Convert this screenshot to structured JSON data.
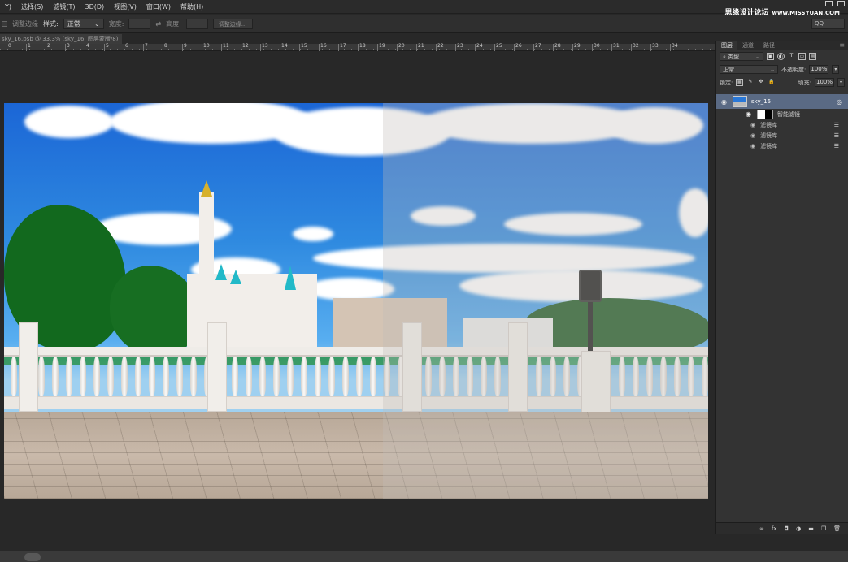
{
  "menu": {
    "items": [
      "Y)",
      "选择(S)",
      "滤镜(T)",
      "3D(D)",
      "视图(V)",
      "窗口(W)",
      "帮助(H)"
    ],
    "brand": "思缘设计论坛",
    "brand_url": "www.MISSYUAN.COM"
  },
  "options": {
    "refine_label": "调整边缘",
    "style_label": "样式:",
    "style_value": "正常",
    "width_label": "宽度:",
    "height_label": "高度:",
    "refine_button": "调整边缘...",
    "workspace": "QQ"
  },
  "document": {
    "tab": "sky_16.psb @ 33.3% (sky_16, 图层蒙版/8)",
    "ruler_labels": [
      "0",
      "1",
      "2",
      "3",
      "4",
      "5",
      "6",
      "7",
      "8",
      "9",
      "10",
      "11",
      "12",
      "13",
      "14",
      "15",
      "16",
      "17",
      "18",
      "19",
      "20",
      "21",
      "22",
      "23",
      "24",
      "25",
      "26",
      "27",
      "28",
      "29",
      "30",
      "31",
      "32",
      "33",
      "34"
    ]
  },
  "panel": {
    "tabs": [
      "图层",
      "通道",
      "路径"
    ],
    "filter_kind": "类型",
    "blend_mode": "正常",
    "opacity_label": "不透明度:",
    "opacity_value": "100%",
    "lock_label": "锁定:",
    "fill_label": "填充:",
    "fill_value": "100%",
    "layer_name": "sky_16",
    "smart_filter_label": "智能滤镜",
    "filters": [
      "滤镜库",
      "滤镜库",
      "滤镜库"
    ],
    "footer_icons": [
      "link-icon",
      "fx-icon",
      "mask-icon",
      "adjustment-icon",
      "folder-icon",
      "new-layer-icon",
      "trash-icon"
    ],
    "fx_label": "fx"
  }
}
